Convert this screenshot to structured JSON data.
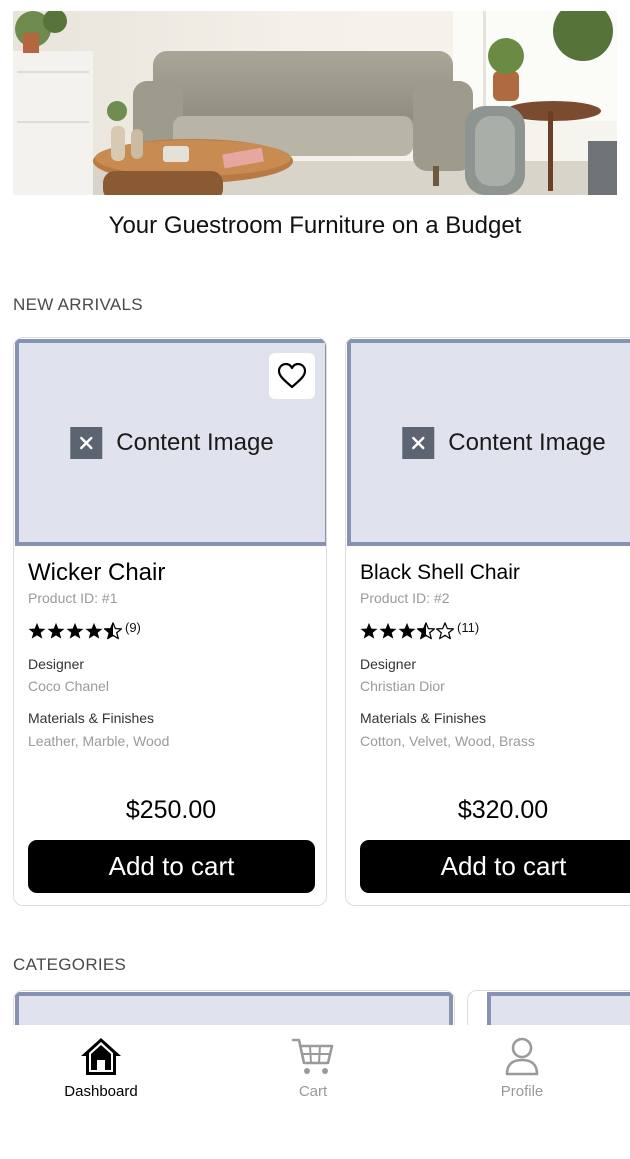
{
  "hero": {
    "headline": "Your Guestroom Furniture on a Budget"
  },
  "sections": {
    "new_arrivals": "NEW ARRIVALS",
    "categories": "CATEGORIES"
  },
  "products": [
    {
      "name": "Wicker Chair",
      "product_id": "Product ID: #1",
      "rating": 4.5,
      "review_count": "(9)",
      "designer_label": "Designer",
      "designer": "Coco Chanel",
      "materials_label": "Materials & Finishes",
      "materials": "Leather, Marble, Wood",
      "price": "$250.00",
      "image_placeholder": "Content Image",
      "add_to_cart": "Add to cart"
    },
    {
      "name": "Black Shell Chair",
      "product_id": "Product ID: #2",
      "rating": 3.5,
      "review_count": "(11)",
      "designer_label": "Designer",
      "designer": "Christian Dior",
      "materials_label": "Materials & Finishes",
      "materials": "Cotton, Velvet, Wood, Brass",
      "price": "$320.00",
      "image_placeholder": "Content Image",
      "add_to_cart": "Add to cart"
    }
  ],
  "bottom_nav": [
    {
      "label": "Dashboard",
      "icon": "home-icon",
      "active": true
    },
    {
      "label": "Cart",
      "icon": "cart-icon",
      "active": false
    },
    {
      "label": "Profile",
      "icon": "profile-icon",
      "active": false
    }
  ],
  "colors": {
    "placeholder_border": "#8791b0",
    "placeholder_fill": "#e0e3ed",
    "button": "#000000",
    "inactive_nav": "#999999"
  }
}
